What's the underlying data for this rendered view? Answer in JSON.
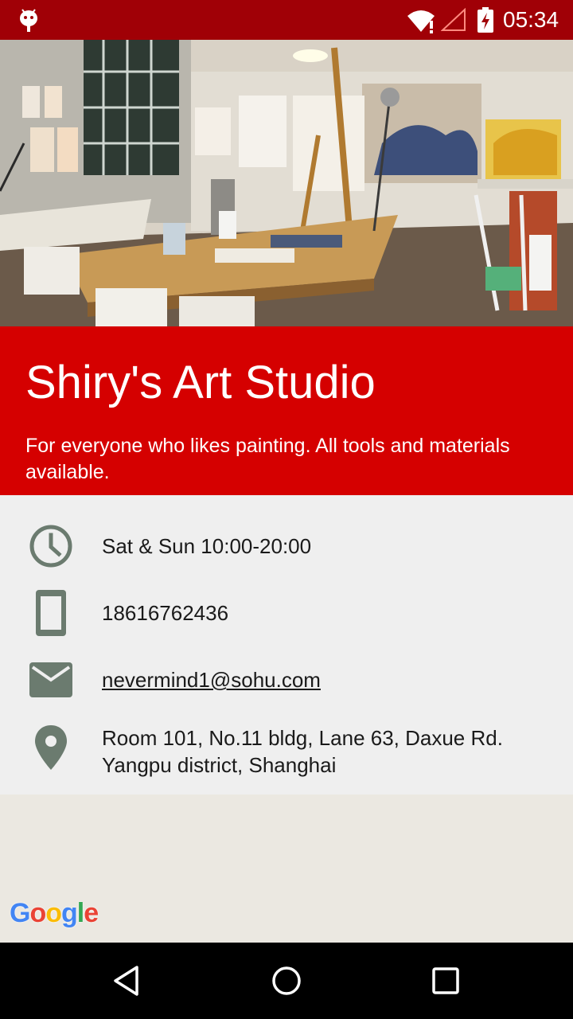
{
  "status_bar": {
    "time": "05:34",
    "icons": [
      "android-debug-icon",
      "wifi-icon",
      "cell-signal-icon",
      "battery-charging-icon"
    ]
  },
  "hero": {
    "image": "art-studio-photo"
  },
  "studio": {
    "name": "Shiry's Art Studio",
    "description": "For everyone who likes painting. All tools and materials available."
  },
  "info": {
    "hours": "Sat & Sun 10:00-20:00",
    "phone": "18616762436",
    "email": "nevermind1@sohu.com",
    "address": "Room 101, No.11 bldg, Lane 63, Daxue Rd. Yangpu district, Shanghai"
  },
  "map": {
    "logo": "Google"
  },
  "colors": {
    "status_bar": "#a00006",
    "accent_red": "#d50000",
    "icon_gray_green": "#6b7b6f",
    "info_bg": "#efefef",
    "map_bg": "#ebe8e1"
  }
}
